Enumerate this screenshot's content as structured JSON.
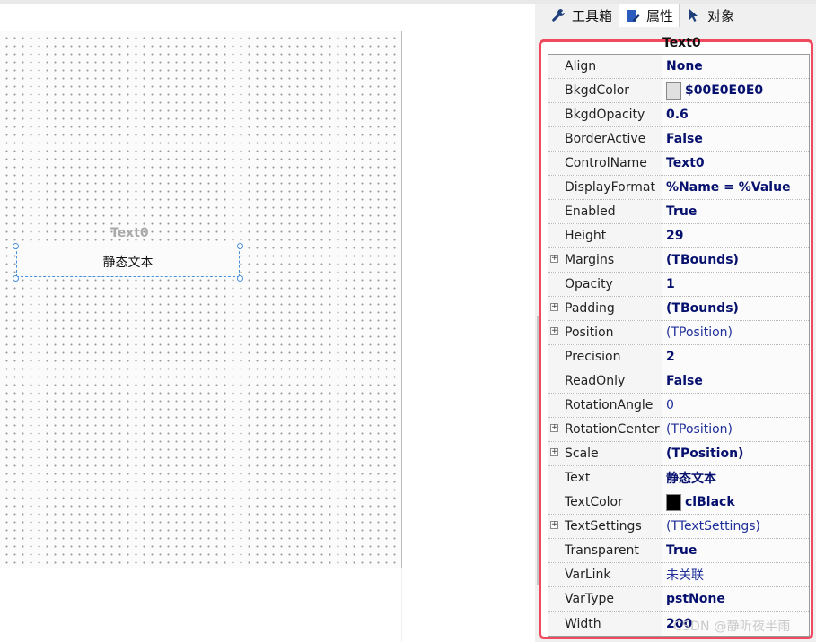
{
  "tabs": [
    {
      "label": "工具箱",
      "icon": "wrench-icon",
      "active": false
    },
    {
      "label": "属性",
      "icon": "edit-icon",
      "active": true
    },
    {
      "label": "对象",
      "icon": "pointer-icon",
      "active": false
    }
  ],
  "canvas": {
    "control_label": "Text0",
    "control_text": "静态文本"
  },
  "inspector": {
    "title": "Text0",
    "highlight_color": "#f04a5e",
    "properties": [
      {
        "name": "Align",
        "value": "None",
        "style": "bold",
        "expandable": false
      },
      {
        "name": "BkgdColor",
        "value": "$00E0E0E0",
        "style": "bold",
        "expandable": false,
        "swatch": "#e0e0e0"
      },
      {
        "name": "BkgdOpacity",
        "value": "0.6",
        "style": "bold",
        "expandable": false
      },
      {
        "name": "BorderActive",
        "value": "False",
        "style": "bold",
        "expandable": false
      },
      {
        "name": "ControlName",
        "value": "Text0",
        "style": "bold",
        "expandable": false
      },
      {
        "name": "DisplayFormat",
        "value": "%Name = %Value",
        "style": "bold",
        "expandable": false
      },
      {
        "name": "Enabled",
        "value": "True",
        "style": "bold",
        "expandable": false
      },
      {
        "name": "Height",
        "value": "29",
        "style": "bold",
        "expandable": false
      },
      {
        "name": "Margins",
        "value": "(TBounds)",
        "style": "bold",
        "expandable": true
      },
      {
        "name": "Opacity",
        "value": "1",
        "style": "bold",
        "expandable": false
      },
      {
        "name": "Padding",
        "value": "(TBounds)",
        "style": "bold",
        "expandable": true
      },
      {
        "name": "Position",
        "value": "(TPosition)",
        "style": "normal",
        "expandable": true
      },
      {
        "name": "Precision",
        "value": "2",
        "style": "bold",
        "expandable": false
      },
      {
        "name": "ReadOnly",
        "value": "False",
        "style": "bold",
        "expandable": false
      },
      {
        "name": "RotationAngle",
        "value": "0",
        "style": "normal",
        "expandable": false
      },
      {
        "name": "RotationCenter",
        "value": "(TPosition)",
        "style": "normal",
        "expandable": true
      },
      {
        "name": "Scale",
        "value": "(TPosition)",
        "style": "bold",
        "expandable": true
      },
      {
        "name": "Text",
        "value": "静态文本",
        "style": "bold",
        "expandable": false
      },
      {
        "name": "TextColor",
        "value": "clBlack",
        "style": "bold",
        "expandable": false,
        "swatch": "#000000"
      },
      {
        "name": "TextSettings",
        "value": "(TTextSettings)",
        "style": "normal",
        "expandable": true
      },
      {
        "name": "Transparent",
        "value": "True",
        "style": "bold",
        "expandable": false
      },
      {
        "name": "VarLink",
        "value": "未关联",
        "style": "normal",
        "expandable": false
      },
      {
        "name": "VarType",
        "value": "pstNone",
        "style": "bold",
        "expandable": false
      },
      {
        "name": "Width",
        "value": "200",
        "style": "bold",
        "expandable": false
      }
    ]
  },
  "watermark": "CSDN @静听夜半雨"
}
